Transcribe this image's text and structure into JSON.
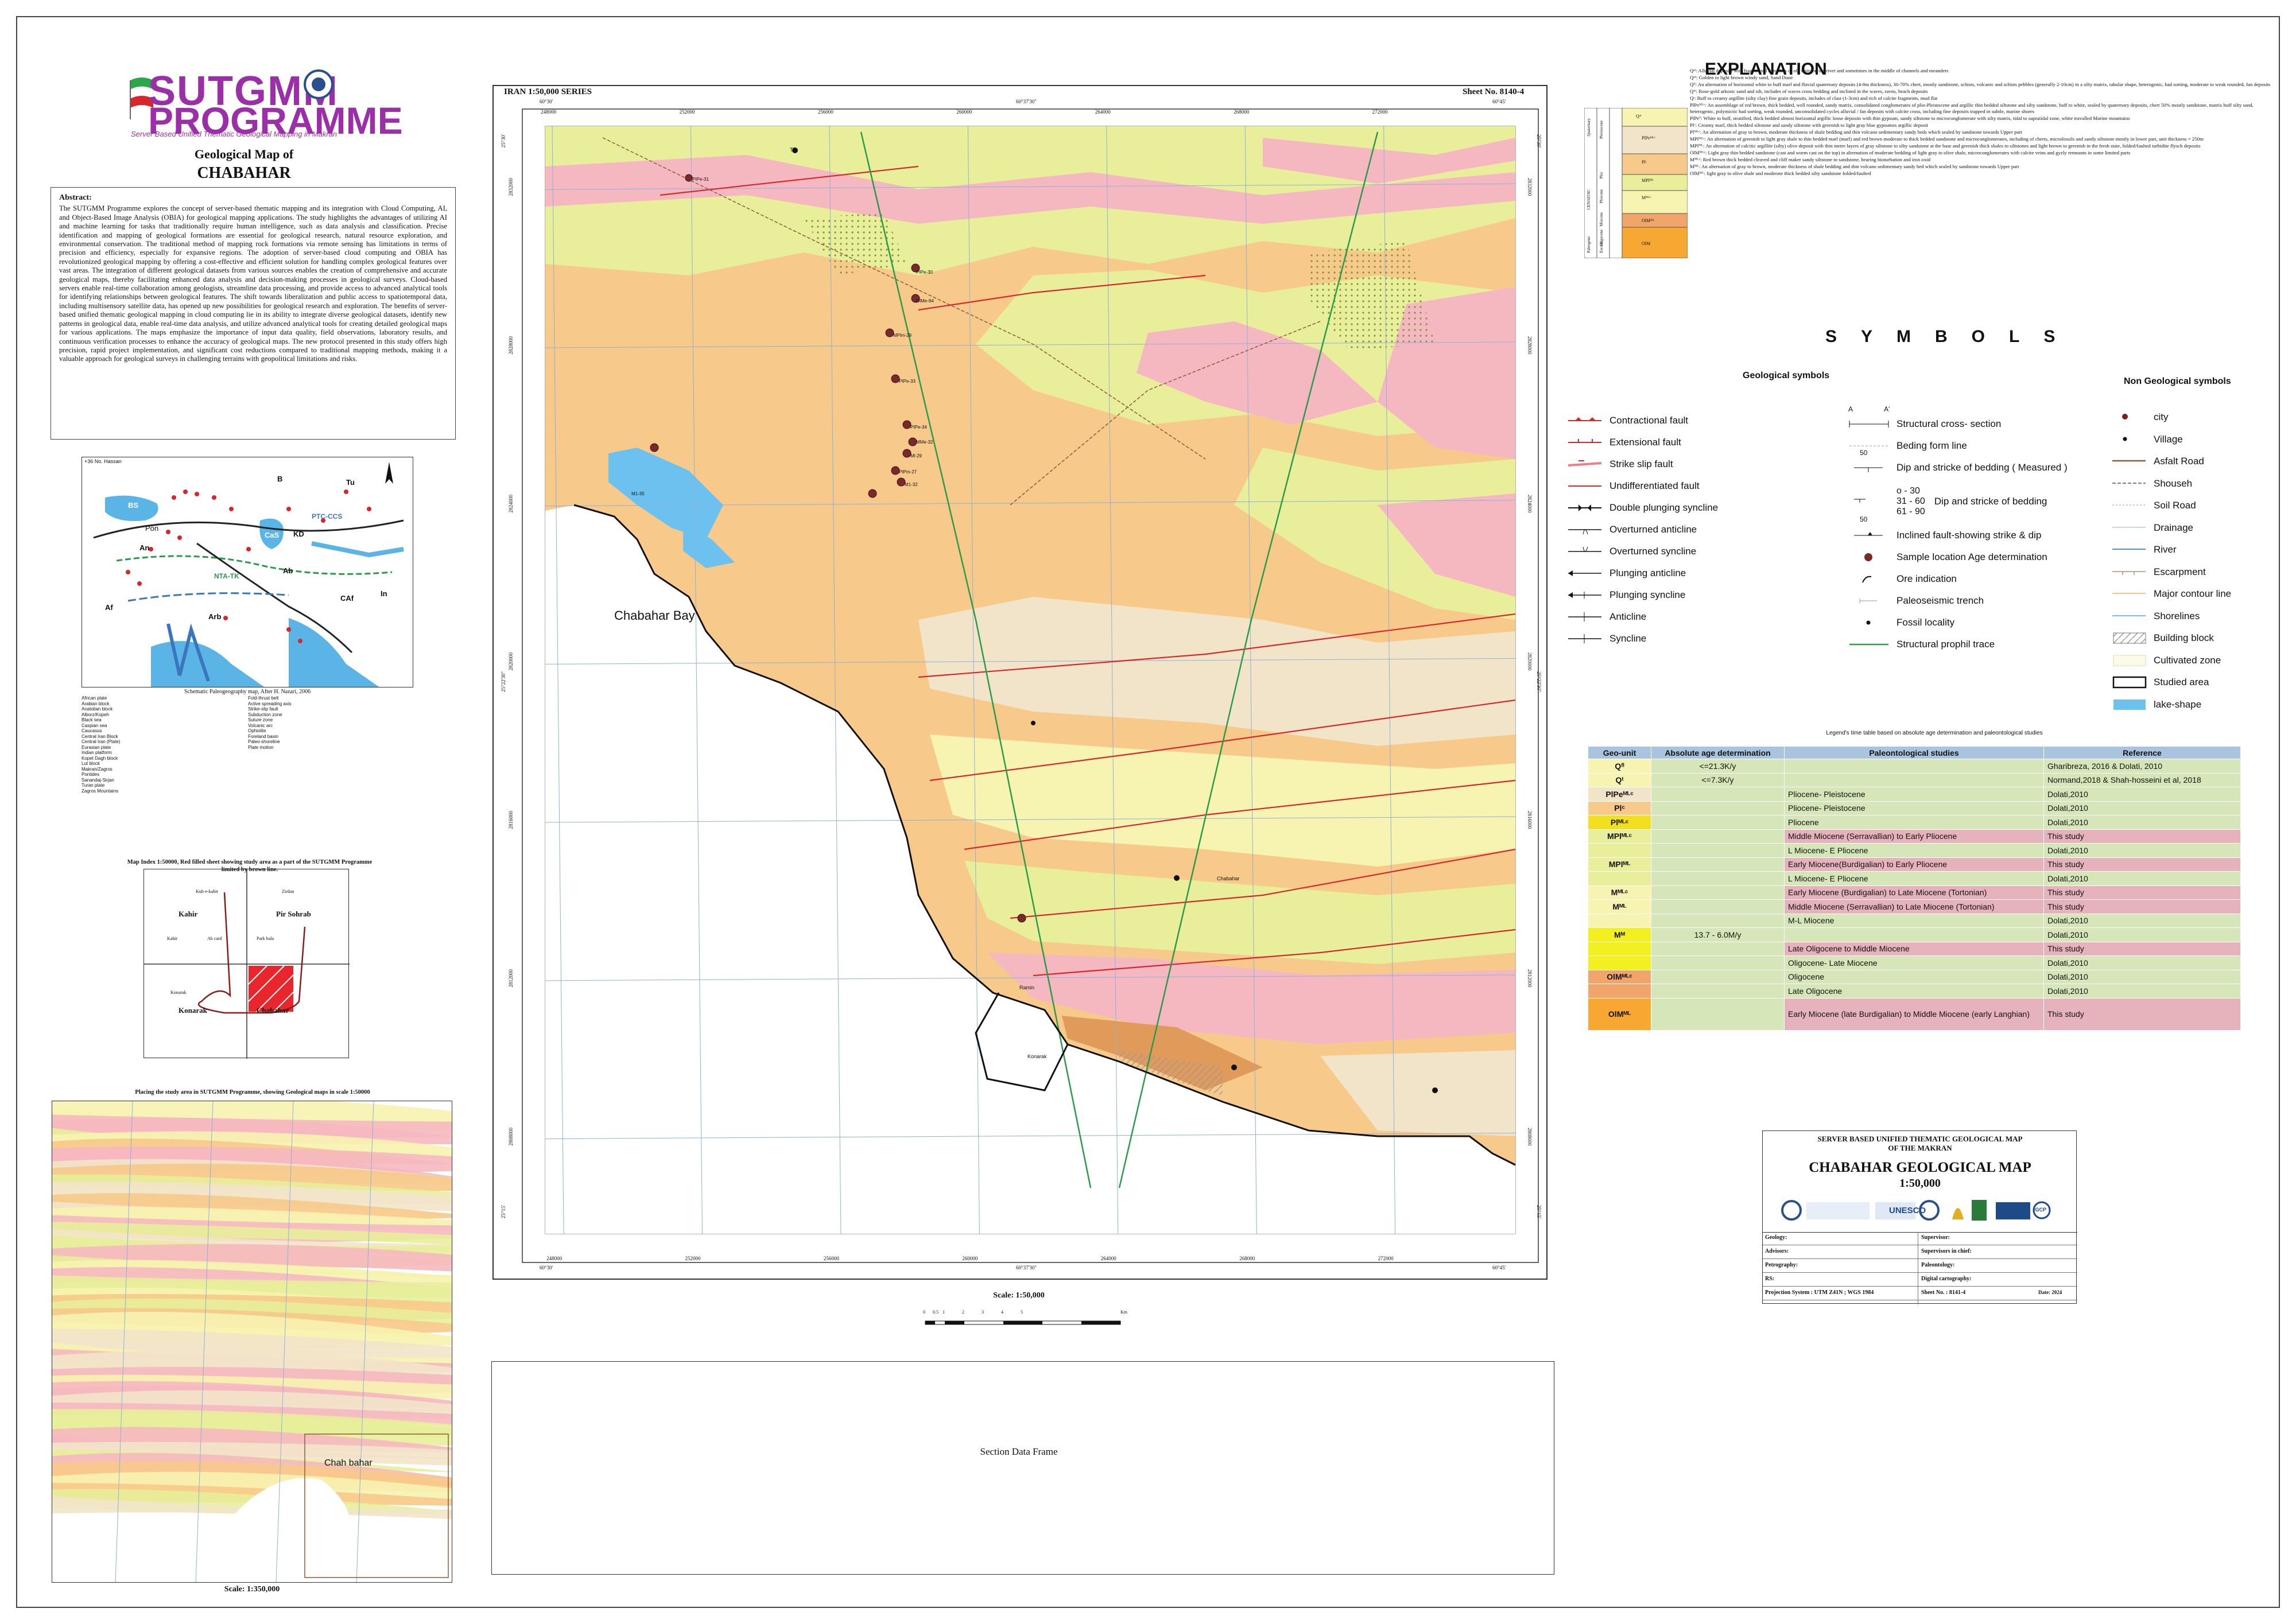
{
  "header": {
    "logo_line1": "SUTGMM",
    "logo_line2": "PROGRAMME",
    "tagline": "Server Based Unified Thematic Geological Mapping in Makran",
    "map_title": "Geological Map of",
    "map_name": "CHABAHAR"
  },
  "abstract": {
    "heading": "Abstract:",
    "text": "The SUTGMM Programme explores the concept of server-based thematic mapping and its integration with Cloud Computing, AI, and Object-Based Image Analysis (OBIA) for geological mapping applications. The study highlights the advantages of utilizing AI and machine learning for tasks that traditionally require human intelligence, such as data analysis and classification. Precise identification and mapping of geological formations are essential for geological research, natural resource exploration, and environmental conservation. The traditional method of mapping rock formations via remote sensing has limitations in terms of precision and efficiency, especially for expansive regions. The adoption of server-based cloud computing and OBIA has revolutionized geological mapping by offering a cost-effective and efficient solution for handling complex geological features over vast areas. The integration of different geological datasets from various sources enables the creation of comprehensive and accurate geological maps, thereby facilitating enhanced data analysis and decision-making processes in geological surveys. Cloud-based servers enable real-time collaboration among geologists, streamline data processing, and provide access to advanced analytical tools for identifying relationships between geological features. The shift towards liberalization and public access to spatiotemporal data, including multisensory satellite data, has opened up new possibilities for geological research and exploration. The benefits of server-based unified thematic geological mapping in cloud computing lie in its ability to integrate diverse geological datasets, identify new patterns in geological data, enable real-time data analysis, and utilize advanced analytical tools for creating detailed geological maps for various applications. The maps emphasize the importance of input data quality, field observations, laboratory results, and continuous verification processes to enhance the accuracy of geological maps. The new protocol presented in this study offers high precision, rapid project implementation, and significant cost reductions compared to traditional mapping methods, making it a valuable approach for geological surveys in challenging terrains with geopolitical limitations and risks."
  },
  "paleo_map": {
    "corner_label": "+36 No. Hassan",
    "labels": [
      "BS",
      "Pon",
      "An",
      "CaS",
      "KD",
      "Ab",
      "Af",
      "Arb",
      "CAf",
      "In",
      "PTC-CCS",
      "NTA-TK",
      "Tu",
      "B"
    ],
    "caption": "Schematic Paleogeography map, After H. Nazari, 2006",
    "legend_left": [
      "African plate",
      "Arabian block",
      "Anatolian block",
      "Alborz/Kopeh",
      "Black sea",
      "Caspian sea",
      "Caucasus",
      "Central Iran Block",
      "Central Iran (Plate)",
      "Eurasian plate",
      "Indian platform",
      "Kopet Dagh block",
      "Lut block",
      "Makran/Zagros",
      "Pontides",
      "Sanandaj-Sirjan",
      "Turan plate",
      "Zagros Mountains"
    ],
    "legend_right": [
      "Fold-thrust belt",
      "Active spreading axis",
      "Strike-slip fault",
      "Subduction zone",
      "Suture zone",
      "Volcanic arc",
      "Ophiolite",
      "Foreland basin",
      "Paleo-shoreline",
      "Plate motion"
    ]
  },
  "index_map": {
    "caption": "Map Index 1:50000, Red filled sheet showing study area as a part of the SUTGMM Programme limited by brown line.",
    "cells": [
      {
        "name": "Kahir",
        "sub": "Kuh-e-kahir"
      },
      {
        "name": "Pir Sohrab",
        "sub": "Zirdan"
      },
      {
        "name": "",
        "sub": "Kahir"
      },
      {
        "name": "",
        "sub": "Ab card"
      },
      {
        "name": "",
        "sub": "Park bala"
      },
      {
        "name": "Konarak",
        "sub": "Konarak"
      },
      {
        "name": "Chabahar",
        "sub": ""
      }
    ]
  },
  "regional_map": {
    "caption": "Placing the study area in SUTGMM Programme, showing Geological maps in scale 1:50000",
    "place_label": "Chah bahar",
    "scale": "Scale: 1:350,000"
  },
  "main_map": {
    "series": "IRAN 1:50,000 SERIES",
    "sheet_no": "Sheet No. 8140-4",
    "bay_label": "Chabahar Bay",
    "town_labels": [
      "Chabahar",
      "Konarak",
      "Ramin",
      "Tis"
    ],
    "easting_ticks": [
      "248000",
      "252000",
      "256000",
      "260000",
      "264000",
      "268000",
      "272000"
    ],
    "northing_ticks": [
      "2808000",
      "2812000",
      "2816000",
      "2820000",
      "2824000",
      "2828000",
      "2832000"
    ],
    "corner_coords": {
      "top_left_lon": "60°30'",
      "top_mid_lon": "60°37'30\"",
      "top_right_lon": "60°45'",
      "left_top_lat": "25°30'",
      "left_mid_lat": "25°22'30\"",
      "left_bottom_lat": "25°15'"
    },
    "sample_labels": [
      "PIPe-31",
      "PIPe-30",
      "OlMe-94",
      "MPlm-29",
      "PIPe-33",
      "PIPe-34",
      "MMe-32",
      "Ml-29",
      "PIPm-27",
      "M1-32",
      "M1-35"
    ],
    "scale": "Scale: 1:50,000",
    "scale_bar_ticks": [
      "0",
      "0.5",
      "1",
      "2",
      "3",
      "4",
      "5",
      "Km"
    ],
    "section_frame": "Section Data Frame"
  },
  "explanation": {
    "title": "EXPLANATION",
    "lines": [
      "Qᵃˡ: Alluvial deposits with fragmented remnants of old units on the river and sometimes in the middle of channels and meanders",
      "Qᵉᵒ: Golden to light brown windy sand, Sand Dune",
      "Qᶠˡ: An alternation of horizontal white to buff marl and fluvial quaternary deposits (4-8m thickness), 30-70% chert, mostly sandstone, schists, volcanic and schists pebbles (generally 2-10cm) in a silty matrix, tabular shape, heterogenic, bad sorting, moderate to weak rounded, fan deposits",
      "Qᵐ: Rose-gold arkosic sand and silt, includes of waves cross bedding and inclined in the waves, ravns, beach deposits",
      "Qᵗ: Buff to creamy argillite (silty clay) fine grain deposits, includes of clast (1-3cm) and rich of calcite fragments, mud flat",
      "PlPeᴹᴸᶜ: An assemblage of red brown, thick bedded, well rounded, sandy matrix, consolidated conglomerates of plio-Pleistocene and argillic thin bedded siltstone and silty sandstone, buff to white, sealed by quaternary deposits, chert 50% mostly sandstone, matrix buff silty sand, heterogenic, polymictic bad sorting, weak rounded, unconsolidated cycles alluvial / fan deposits with calcite cross, including fine deposits trapped in subtle, marine shores",
      "PlPeᴾ: White to buff, stratified, thick bedded almost horizontal argillic loose deposits with thin gypsum, sandy siltstone to microconglomerate with silty matrix, tidal to supratidal zone, white travalled Marine mountains",
      "Plᶜ: Creamy marl, thick bedded siltstone and sandy siltstone with greenish to light gray blue gypsumes argillic deposit",
      "Plᴹᴸᶜ: An alternation of gray to brown, moderate thickness of shale bedding and thin volcano sedimentary sandy beds which sealed by sandstone towards Upper part",
      "MPlᴹᴸᶜ: An alternation of greenish to light gray shale to thin bedded marl (marl) and red brown moderate to thick bedded sandstone and microconglomerates, including of cherts, microfossils and sandy siltstone mostly in lower part, unit thickness = 250m",
      "MPlᴹᴸ: An alternation of calcitic argillite (silty) olive deposit with thin metre layers of gray siltstone to silty sandstone at the base and greenish thick shales to siltstones and light brown to greenish in the fresh state, folded/faulted turbidite flysch deposits",
      "OlMᴹᴸᶜ: Light gray thin bedded sandstone (cast and worm cast on the top) in alternation of moderate bedding of light gray to olive shale, microconglomerates with calcite veins and gyzly remnants in some limited parts",
      "Mᴹᴸᶜ: Red brown thick bedded cleaved and cliff maker sandy siltstone to sandstone, bearing bioturbation and iron oxid",
      "Mᴹᴸ: An alternation of gray to brown, moderate thickness of shale bedding and thin volcano sedimentary sandy bed which sealed by sandstone towards Upper part",
      "OlMᴹᴸ: light gray to olive shale and moderate thick bedded silty sandstone folded/faulted"
    ],
    "column_eras": [
      "Quaternary",
      "Pleistocene",
      "Plio",
      "Pliocene",
      "Miocene",
      "Oligocene",
      "CENOZOIC",
      "Paleogene",
      "Eocene"
    ],
    "column_units": [
      "Qᵃˡ",
      "PlPeᴹᴸᶜ",
      "Plᶜ",
      "Mᴹᴸᶜ",
      "MPlᴹᴸ",
      "OlMᴹᴸ",
      "OlM"
    ]
  },
  "symbols": {
    "title": "SYMBOLS",
    "geo_title": "Geological symbols",
    "nongeo_title": "Non Geological symbols",
    "geo_col1": [
      "Contractional fault",
      "Extensional fault",
      "Strike slip fault",
      "Undifferentiated fault",
      "Double plunging syncline",
      "Overturned anticline",
      "Overturned syncline",
      "Plunging anticline",
      "Plunging syncline",
      "Anticline",
      "Syncline"
    ],
    "geo_col2": [
      "Structural cross- section",
      "Beding form line",
      "Dip and stricke of bedding ( Measured )",
      "Dip and stricke of bedding",
      "Inclined fault-showing strike & dip",
      "Sample location Age determination",
      "Ore indication",
      "Paleoseismic trench",
      "Fossil locality",
      "Structural prophil trace"
    ],
    "dip_ranges": [
      "o - 30",
      "31 - 60",
      "61 - 90"
    ],
    "dip_values": [
      "50",
      "50"
    ],
    "section_letters": [
      "A",
      "A'"
    ],
    "nongeo": [
      "city",
      "Village",
      "Asfalt Road",
      "Shouseh",
      "Soil Road",
      "Drainage",
      "River",
      "Escarpment",
      "Major contour line",
      "Shorelines",
      "Building block",
      "Cultivated zone",
      "Studied area",
      "lake-shape"
    ]
  },
  "age_table": {
    "caption": "Legend's time table based on absolute age determination and paleontological studies",
    "headers": [
      "Geo-unit",
      "Absolute age determination",
      "Paleontological studies",
      "Reference"
    ],
    "rows": [
      {
        "unit": "Qᶠˡ",
        "abs": "<=21.3K/y",
        "pal": "",
        "ref": "Gharibreza, 2016 & Dolati, 2010",
        "hl": false
      },
      {
        "unit": "Qᵗ",
        "abs": "<=7.3K/y",
        "pal": "",
        "ref": "Normand,2018 & Shah-hosseini et al, 2018",
        "hl": false
      },
      {
        "unit": "PlPeᴹᴸᶜ",
        "abs": "",
        "pal": "Pliocene- Pleistocene",
        "ref": "Dolati,2010",
        "hl": false
      },
      {
        "unit": "Plᶜ",
        "abs": "",
        "pal": "Pliocene- Pleistocene",
        "ref": "Dolati,2010",
        "hl": false
      },
      {
        "unit": "Plᴹᴸᶜ",
        "abs": "",
        "pal": "Pliocene",
        "ref": "Dolati,2010",
        "hl": false
      },
      {
        "unit": "MPlᴹᴸᶜ",
        "abs": "",
        "pal": "Middle Miocene (Serravallian) to Early Pliocene",
        "ref": "This study",
        "hl": true
      },
      {
        "unit": "",
        "abs": "",
        "pal": "L Miocene- E Pliocene",
        "ref": "Dolati,2010",
        "hl": false
      },
      {
        "unit": "MPlᴹᴸ",
        "abs": "",
        "pal": "Early Miocene(Burdigalian) to Early Pliocene",
        "ref": "This study",
        "hl": true
      },
      {
        "unit": "",
        "abs": "",
        "pal": "L Miocene- E Pliocene",
        "ref": "Dolati,2010",
        "hl": false
      },
      {
        "unit": "Mᴹᴸᶜ",
        "abs": "",
        "pal": "Early Miocene (Burdigalian) to Late Miocene (Tortonian)",
        "ref": "This study",
        "hl": true
      },
      {
        "unit": "Mᴹᴸ",
        "abs": "",
        "pal": "Middle Miocene (Serravallian) to Late Miocene (Tortonian)",
        "ref": "This study",
        "hl": true
      },
      {
        "unit": "",
        "abs": "",
        "pal": "M-L Miocene",
        "ref": "Dolati,2010",
        "hl": false
      },
      {
        "unit": "Mᴹ",
        "abs": "13.7 - 6.0M/y",
        "pal": "",
        "ref": "Dolati,2010",
        "hl": false
      },
      {
        "unit": "",
        "abs": "",
        "pal": "Late Oligocene to Middle Miocene",
        "ref": "This study",
        "hl": true
      },
      {
        "unit": "",
        "abs": "",
        "pal": "Oligocene- Late Miocene",
        "ref": "Dolati,2010",
        "hl": false
      },
      {
        "unit": "OlMᴹᴸᶜ",
        "abs": "",
        "pal": "Oligocene",
        "ref": "Dolati,2010",
        "hl": false
      },
      {
        "unit": "",
        "abs": "",
        "pal": "Late Oligocene",
        "ref": "Dolati,2010",
        "hl": false
      },
      {
        "unit": "OlMᴹᴸ",
        "abs": "",
        "pal": "Early Miocene (late Burdigalian) to Middle Miocene (early Langhian)",
        "ref": "This study",
        "hl": true
      }
    ]
  },
  "title_block": {
    "heading1": "SERVER BASED UNIFIED THEMATIC GEOLOGICAL MAP",
    "heading2": "OF THE MAKRAN",
    "title": "CHABAHAR GEOLOGICAL MAP",
    "scale": "1:50,000",
    "fields_left": [
      "Geology:",
      "Advisors:",
      "Petrography:",
      "RS:",
      "Projection System : UTM Z41N ; WGS 1984"
    ],
    "fields_right": [
      "Supervisor:",
      "Supervisors in chief:",
      "Paleontology:",
      "Digital cartography:",
      "Sheet No. : 8141-4"
    ],
    "date": "Date: 2024",
    "logos": [
      "UNESCO",
      "IGCP"
    ]
  },
  "colors": {
    "fan_orange": "#f7c98a",
    "pink_unit": "#f6b8c0",
    "yellow_green": "#e8ee9a",
    "light_yellow": "#f7f3b0",
    "cream": "#f2e4c9",
    "sea": "#6cc1ef",
    "fault_red": "#d9262b",
    "profile_green": "#2a9b4a",
    "table_header": "#a9c4de",
    "table_green": "#d6e6b8",
    "table_pink": "#e6b3bd"
  }
}
